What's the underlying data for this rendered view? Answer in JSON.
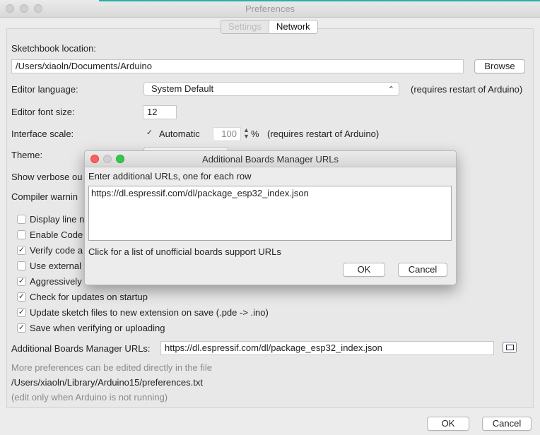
{
  "window": {
    "title": "Preferences"
  },
  "tabs": [
    {
      "label": "Settings",
      "active": false
    },
    {
      "label": "Network",
      "active": true
    }
  ],
  "sketchbook": {
    "label": "Sketchbook location:",
    "value": "/Users/xiaoln/Documents/Arduino",
    "browse": "Browse"
  },
  "editor_language": {
    "label": "Editor language:",
    "value": "System Default",
    "note": "(requires restart of Arduino)"
  },
  "editor_font": {
    "label": "Editor font size:",
    "value": "12"
  },
  "interface_scale": {
    "label": "Interface scale:",
    "auto_label": "Automatic",
    "auto_checked": true,
    "value": "100",
    "unit": "%",
    "note": "(requires restart of Arduino)"
  },
  "theme": {
    "label": "Theme:"
  },
  "verbose": {
    "label": "Show verbose ou"
  },
  "compiler_warnings": {
    "label": "Compiler warnin"
  },
  "checkboxes": [
    {
      "label": "Display line n",
      "checked": false
    },
    {
      "label": "Enable Code",
      "checked": false
    },
    {
      "label": "Verify code a",
      "checked": true
    },
    {
      "label": "Use external",
      "checked": false
    },
    {
      "label": "Aggressively",
      "checked": true
    },
    {
      "label": "Check for updates on startup",
      "checked": true
    },
    {
      "label": "Update sketch files to new extension on save (.pde -> .ino)",
      "checked": true
    },
    {
      "label": "Save when verifying or uploading",
      "checked": true
    }
  ],
  "boards_urls": {
    "label": "Additional Boards Manager URLs:",
    "value": "https://dl.espressif.com/dl/package_esp32_index.json"
  },
  "more_prefs": {
    "note": "More preferences can be edited directly in the file",
    "path": "/Users/xiaoln/Library/Arduino15/preferences.txt",
    "edit_note": "(edit only when Arduino is not running)"
  },
  "footer": {
    "ok": "OK",
    "cancel": "Cancel"
  },
  "dialog": {
    "title": "Additional Boards Manager URLs",
    "instruction": "Enter additional URLs, one for each row",
    "textarea_value": "https://dl.espressif.com/dl/package_esp32_index.json",
    "link_text": "Click for a list of unofficial boards support URLs",
    "ok": "OK",
    "cancel": "Cancel"
  },
  "colors": {
    "accent": "#2bb0a6",
    "close": "#fc605c",
    "minimize": "#fdbc40",
    "zoom": "#34c84a"
  }
}
